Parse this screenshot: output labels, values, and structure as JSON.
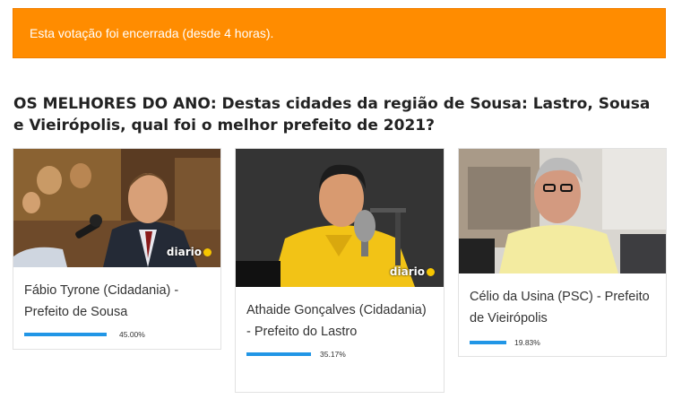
{
  "notice": {
    "text": "Esta votação foi encerrada (desde 4 horas)."
  },
  "poll": {
    "question": "OS MELHORES DO ANO: Destas cidades da região de Sousa: Lastro, Sousa e Vieirópolis, qual foi o melhor prefeito de 2021?"
  },
  "options": [
    {
      "label": "Fábio Tyrone (Cidadania) - Prefeito de Sousa",
      "percent": 45.0,
      "percent_text": "45.00%",
      "logo": "diario"
    },
    {
      "label": "Athaide Gonçalves (Cidadania) - Prefeito do Lastro",
      "percent": 35.17,
      "percent_text": "35.17%",
      "logo": "diario"
    },
    {
      "label": "Célio da Usina (PSC) - Prefeito de Vieirópolis",
      "percent": 19.83,
      "percent_text": "19.83%"
    }
  ],
  "colors": {
    "notice_bg": "#ff8c00",
    "bar": "#2196e6"
  }
}
